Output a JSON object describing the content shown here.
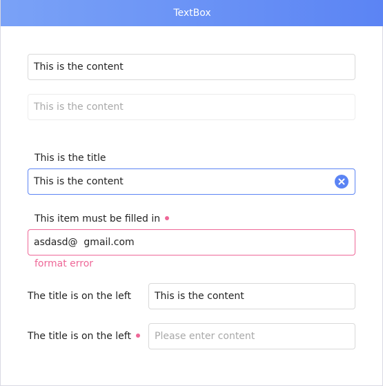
{
  "window": {
    "title": "TextBox"
  },
  "textbox_basic": {
    "value": "This is the content"
  },
  "textbox_disabled": {
    "value": "This is the content"
  },
  "textbox_titled": {
    "title": "This is the title",
    "value": "This is the content",
    "clear_icon": "clear-circle-icon"
  },
  "textbox_required": {
    "title": "This item must be filled in",
    "value": "asdasd@  gmail.com",
    "error": "format error"
  },
  "textbox_left_title": {
    "title": "The title is on the left",
    "value": "This is the content"
  },
  "textbox_left_required": {
    "title": "The title is on the left",
    "placeholder": "Please enter content"
  },
  "colors": {
    "accent": "#5b84f4",
    "error": "#ee6797",
    "border": "#d9d9d9"
  }
}
